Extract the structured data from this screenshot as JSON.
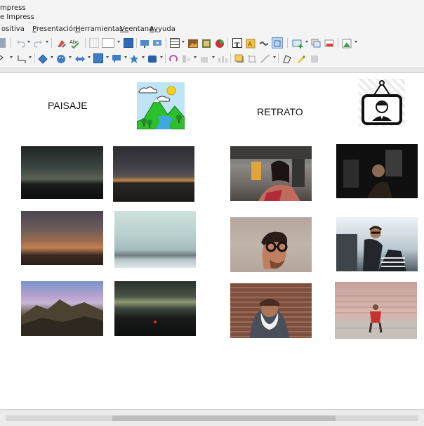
{
  "window": {
    "title_line1": "mpress",
    "title_line2": "e Impress"
  },
  "menu": [
    {
      "text": "ositiva",
      "u": ""
    },
    {
      "text": "resentación",
      "u": "P"
    },
    {
      "text": "erramientas",
      "u": "H"
    },
    {
      "text": "entana",
      "u": "Ve"
    },
    {
      "text": "yuda",
      "u": "Ay"
    }
  ],
  "slide": {
    "left_label": "PAISAJE",
    "right_label": "RETRATO"
  },
  "toolbar1_icons": [
    "save-icon",
    "undo-icon",
    "redo-icon",
    "clear-formatting-icon",
    "spellcheck-icon",
    "grid-icon",
    "display-views-icon",
    "slide-icon",
    "start-presentation-icon",
    "start-current-icon",
    "table-icon",
    "image-icon",
    "movie-icon",
    "chart-icon",
    "textbox-icon",
    "fontwork-icon",
    "special-char-icon",
    "hyperlink-icon",
    "new-slide-icon",
    "duplicate-slide-icon",
    "delete-slide-icon",
    "slide-layout-icon"
  ],
  "toolbar2_icons": [
    "select-icon",
    "line-icon",
    "connector-icon",
    "diamond-shape-icon",
    "smiley-icon",
    "double-arrow-icon",
    "flowchart-icon",
    "callout-icon",
    "star-icon",
    "3d-object-icon",
    "rotate-icon",
    "align-icon",
    "arrange-icon",
    "distribute-icon",
    "shadow-icon",
    "crop-icon",
    "filter-icon",
    "points-icon",
    "glue-icon",
    "toggle-extrusion-icon"
  ],
  "colors": {
    "toolbar_bg": "#f4f4f4",
    "slide_bg": "#ffffff",
    "accent": "#2f6bb5"
  }
}
